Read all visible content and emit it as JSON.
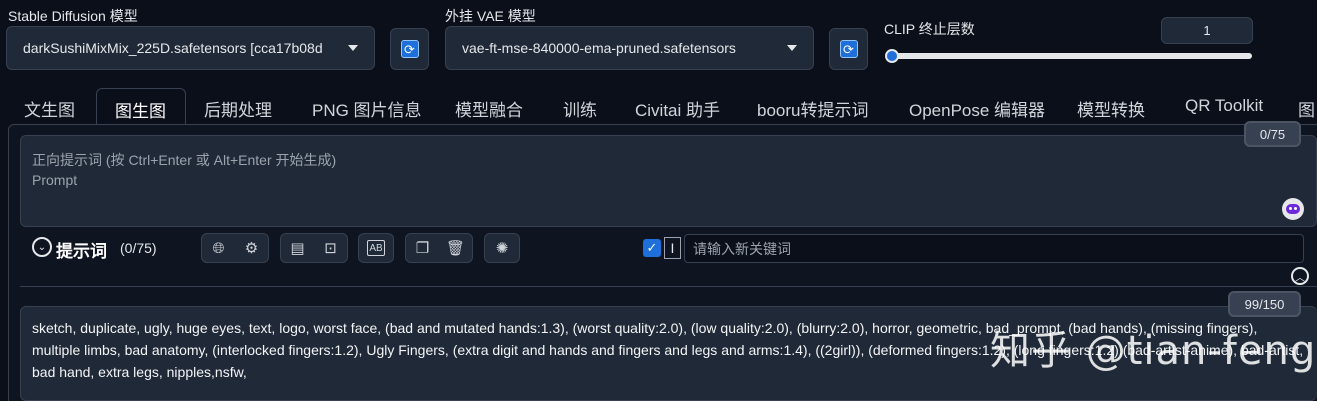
{
  "sd_model": {
    "label": "Stable Diffusion 模型",
    "value": "darkSushiMixMix_225D.safetensors [cca17b08d"
  },
  "vae_model": {
    "label": "外挂 VAE 模型",
    "value": "vae-ft-mse-840000-ema-pruned.safetensors"
  },
  "clip": {
    "label": "CLIP 终止层数",
    "value": "1",
    "slider_fraction": 0.0
  },
  "tabs": [
    {
      "label": "文生图"
    },
    {
      "label": "图生图",
      "active": true
    },
    {
      "label": "后期处理"
    },
    {
      "label": "PNG 图片信息"
    },
    {
      "label": "模型融合"
    },
    {
      "label": "训练"
    },
    {
      "label": "Civitai 助手"
    },
    {
      "label": "booru转提示词"
    },
    {
      "label": "OpenPose 编辑器"
    },
    {
      "label": "模型转换"
    },
    {
      "label": "QR Toolkit"
    },
    {
      "label": "图"
    }
  ],
  "prompt": {
    "counter": "0/75",
    "placeholder_line1": "正向提示词 (按 Ctrl+Enter 或 Alt+Enter 开始生成)",
    "placeholder_line2": "Prompt"
  },
  "toolbar": {
    "title": "提示词",
    "count": "(0/75)",
    "keyword_placeholder": "请输入新关键词"
  },
  "negative": {
    "counter": "99/150",
    "text": "sketch, duplicate, ugly, huge eyes, text, logo,  worst face, (bad and mutated hands:1.3), (worst quality:2.0), (low quality:2.0), (blurry:2.0), horror, geometric, bad_prompt, (bad hands), (missing fingers), multiple limbs, bad anatomy, (interlocked fingers:1.2), Ugly Fingers, (extra digit and hands and fingers and legs and arms:1.4), ((2girl)), (deformed fingers:1.2), (long fingers:1.2),(bad-artist-anime), bad-artist, bad hand, extra legs, nipples,nsfw,"
  },
  "watermark": "知乎 @tian-feng",
  "colors": {
    "accent": "#1e6fd9",
    "bg": "#0b0f19",
    "panel": "#1f2937"
  }
}
